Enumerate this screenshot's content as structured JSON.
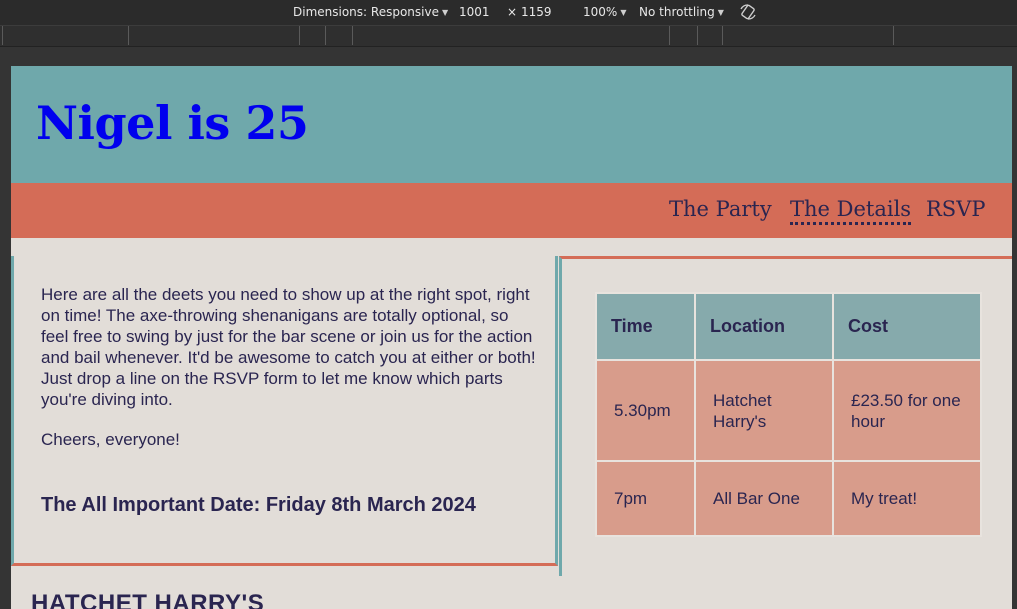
{
  "devtools": {
    "dimensions_label": "Dimensions: Responsive",
    "width": "1001",
    "times": "×",
    "height": "1159",
    "zoom": "100%",
    "throttling": "No throttling",
    "icons": [
      "chevron-down-icon",
      "rotate-icon"
    ]
  },
  "site": {
    "title": "Nigel is 25",
    "nav": [
      "The Party",
      "The Details",
      "RSVP"
    ],
    "active_nav": "The Details",
    "intro": "Here are all the deets you need to show up at the right spot, right on time! The axe-throwing shenanigans are totally optional, so feel free to swing by just for the bar scene or join us for the action and bail whenever. It'd be awesome to catch you at either or both! Just drop a line on the RSVP form to let me know which parts you're diving into.",
    "cheers": "Cheers, everyone!",
    "date_heading": "The All Important Date: Friday 8th March 2024",
    "table": {
      "headers": [
        "Time",
        "Location",
        "Cost"
      ],
      "rows": [
        [
          "5.30pm",
          "Hatchet Harry's",
          "£23.50 for one hour"
        ],
        [
          "7pm",
          "All Bar One",
          "My treat!"
        ]
      ]
    },
    "section_heading": "HATCHET HARRY'S"
  },
  "colors": {
    "header": "#6fa8ab",
    "nav": "#d46c57",
    "page_bg": "#e2ddd8",
    "table_head": "#86aaac",
    "table_cell": "#d89c8b",
    "text": "#2a2550",
    "title_link": "#0000ee"
  }
}
